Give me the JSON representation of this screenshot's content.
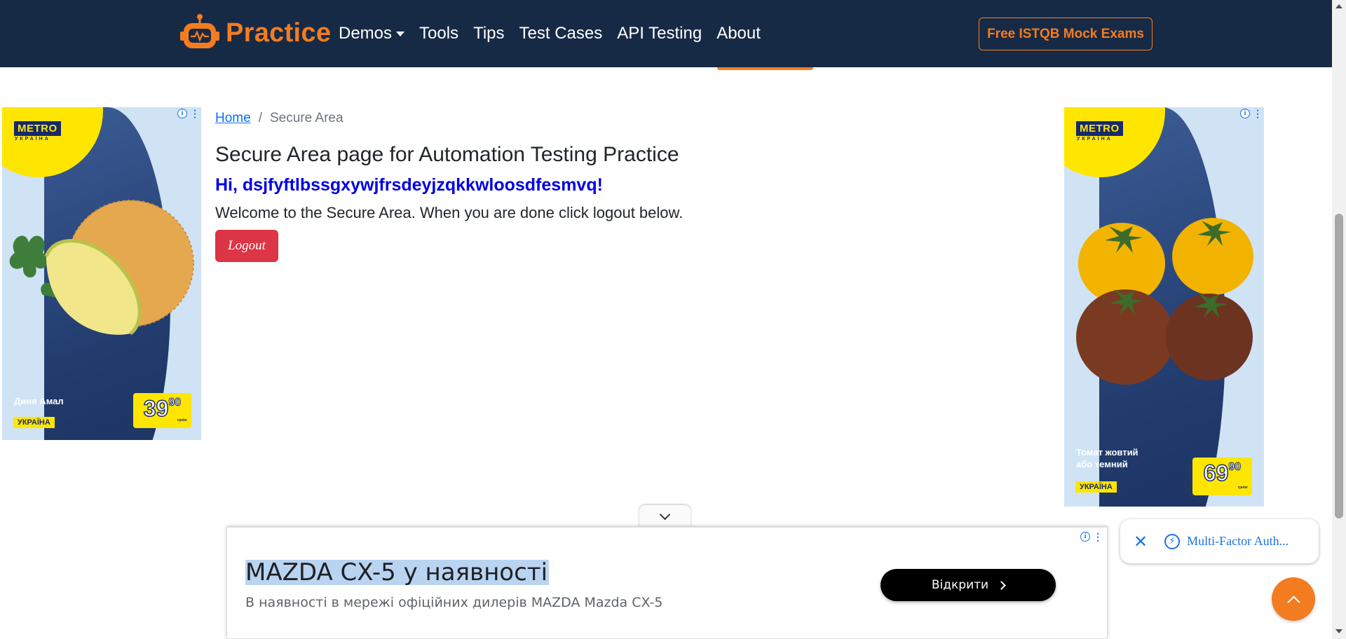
{
  "header": {
    "brand": "Practice",
    "nav": [
      "Demos",
      "Tools",
      "Tips",
      "Test Cases",
      "API Testing",
      "About"
    ],
    "cta": "Free ISTQB Mock Exams"
  },
  "breadcrumb": {
    "home": "Home",
    "separator": "/",
    "current": "Secure Area"
  },
  "main": {
    "title": "Secure Area page for Automation Testing Practice",
    "greeting": "Hi, dsjfyftlbssgxywjfrsdeyjzqkkwloosdfesmvq!",
    "welcome": "Welcome to the Secure Area. When you are done click logout below.",
    "logout_label": "Logout"
  },
  "ads": {
    "left": {
      "brand": "METRO",
      "brand_sub": "УКРАЇНА",
      "product": "Диня Амал",
      "country": "УКРАЇНА",
      "price_int": "39",
      "price_dec": "90",
      "price_unit": "грн/кг"
    },
    "right": {
      "brand": "METRO",
      "brand_sub": "УКРАЇНА",
      "product_line1": "Томат жовтий",
      "product_line2": "або темний",
      "country": "УКРАЇНА",
      "price_int": "69",
      "price_dec": "90",
      "price_unit": "грн/кг"
    },
    "banner": {
      "title": "MAZDA CX-5 у наявності",
      "description": "В наявності в мережі офіційних дилерів MAZDA Mazda CX-5",
      "button": "Відкрити"
    }
  },
  "chip": {
    "text": "Multi-Factor Auth..."
  },
  "colors": {
    "navbar": "#172a45",
    "accent": "#f47c20",
    "logout": "#dc3545",
    "greeting": "#0000e6"
  }
}
